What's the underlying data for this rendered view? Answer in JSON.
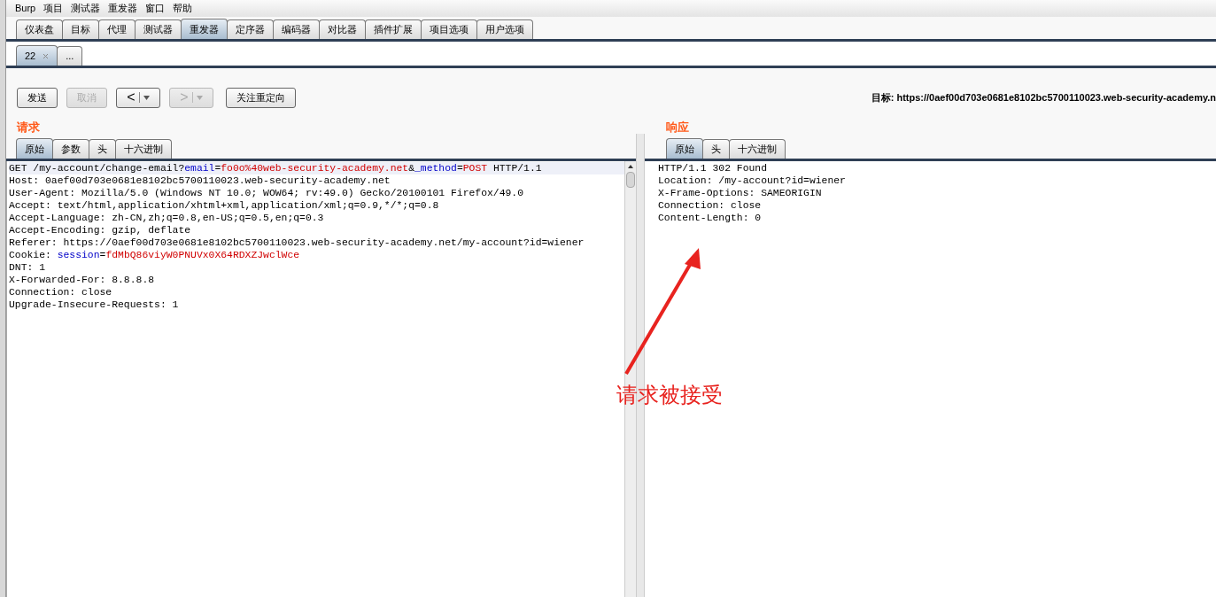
{
  "menu": [
    "Burp",
    "项目",
    "测试器",
    "重发器",
    "窗口",
    "帮助"
  ],
  "tabs": [
    {
      "label": "仪表盘",
      "selected": false
    },
    {
      "label": "目标",
      "selected": false
    },
    {
      "label": "代理",
      "selected": false
    },
    {
      "label": "测试器",
      "selected": false
    },
    {
      "label": "重发器",
      "selected": true
    },
    {
      "label": "定序器",
      "selected": false
    },
    {
      "label": "编码器",
      "selected": false
    },
    {
      "label": "对比器",
      "selected": false
    },
    {
      "label": "插件扩展",
      "selected": false
    },
    {
      "label": "项目选项",
      "selected": false
    },
    {
      "label": "用户选项",
      "selected": false
    }
  ],
  "request_tabs": [
    {
      "label": "22",
      "closable": true,
      "selected": true
    },
    {
      "label": "...",
      "closable": false,
      "selected": false
    }
  ],
  "toolbar": [
    {
      "kind": "text",
      "label": "发送",
      "disabled": false
    },
    {
      "kind": "text",
      "label": "取消",
      "disabled": true
    },
    {
      "kind": "nav",
      "label": "<",
      "disabled": false
    },
    {
      "kind": "nav",
      "label": ">",
      "disabled": true
    },
    {
      "kind": "text",
      "label": "关注重定向",
      "disabled": false
    }
  ],
  "target": {
    "label": "目标:",
    "url": "https://0aef00d703e0681e8102bc5700110023.web-security-academy.n"
  },
  "request": {
    "title": "请求",
    "tabs": [
      {
        "label": "原始",
        "selected": true
      },
      {
        "label": "参数",
        "selected": false
      },
      {
        "label": "头",
        "selected": false
      },
      {
        "label": "十六进制",
        "selected": false
      }
    ],
    "lines": [
      [
        {
          "text": "GET /my-account/change-email?",
          "kind": "plain"
        },
        {
          "text": "email",
          "kind": "param"
        },
        {
          "text": "=",
          "kind": "plain"
        },
        {
          "text": "fo0o%40web-security-academy.net",
          "kind": "value"
        },
        {
          "text": "&",
          "kind": "plain"
        },
        {
          "text": "_method",
          "kind": "param"
        },
        {
          "text": "=",
          "kind": "plain"
        },
        {
          "text": "POST",
          "kind": "value"
        },
        {
          "text": " HTTP/1.1",
          "kind": "plain"
        }
      ],
      [
        {
          "text": "Host: 0aef00d703e0681e8102bc5700110023.web-security-academy.net",
          "kind": "plain"
        }
      ],
      [
        {
          "text": "User-Agent: Mozilla/5.0 (Windows NT 10.0; WOW64; rv:49.0) Gecko/20100101 Firefox/49.0",
          "kind": "plain"
        }
      ],
      [
        {
          "text": "Accept: text/html,application/xhtml+xml,application/xml;q=0.9,*/*;q=0.8",
          "kind": "plain"
        }
      ],
      [
        {
          "text": "Accept-Language: zh-CN,zh;q=0.8,en-US;q=0.5,en;q=0.3",
          "kind": "plain"
        }
      ],
      [
        {
          "text": "Accept-Encoding: gzip, deflate",
          "kind": "plain"
        }
      ],
      [
        {
          "text": "Referer: https://0aef00d703e0681e8102bc5700110023.web-security-academy.net/my-account?id=wiener",
          "kind": "plain"
        }
      ],
      [
        {
          "text": "Cookie: ",
          "kind": "plain"
        },
        {
          "text": "session",
          "kind": "param"
        },
        {
          "text": "=",
          "kind": "plain"
        },
        {
          "text": "fdMbQ86viyW0PNUVx0X64RDXZJwclWce",
          "kind": "value"
        }
      ],
      [
        {
          "text": "DNT: 1",
          "kind": "plain"
        }
      ],
      [
        {
          "text": "X-Forwarded-For: 8.8.8.8",
          "kind": "plain"
        }
      ],
      [
        {
          "text": "Connection: close",
          "kind": "plain"
        }
      ],
      [
        {
          "text": "Upgrade-Insecure-Requests: 1",
          "kind": "plain"
        }
      ]
    ]
  },
  "response": {
    "title": "响应",
    "tabs": [
      {
        "label": "原始",
        "selected": true
      },
      {
        "label": "头",
        "selected": false
      },
      {
        "label": "十六进制",
        "selected": false
      }
    ],
    "lines": [
      "HTTP/1.1 302 Found",
      "Location: /my-account?id=wiener",
      "X-Frame-Options: SAMEORIGIN",
      "Connection: close",
      "Content-Length: 0"
    ]
  },
  "annotation": {
    "text": "请求被接受"
  }
}
